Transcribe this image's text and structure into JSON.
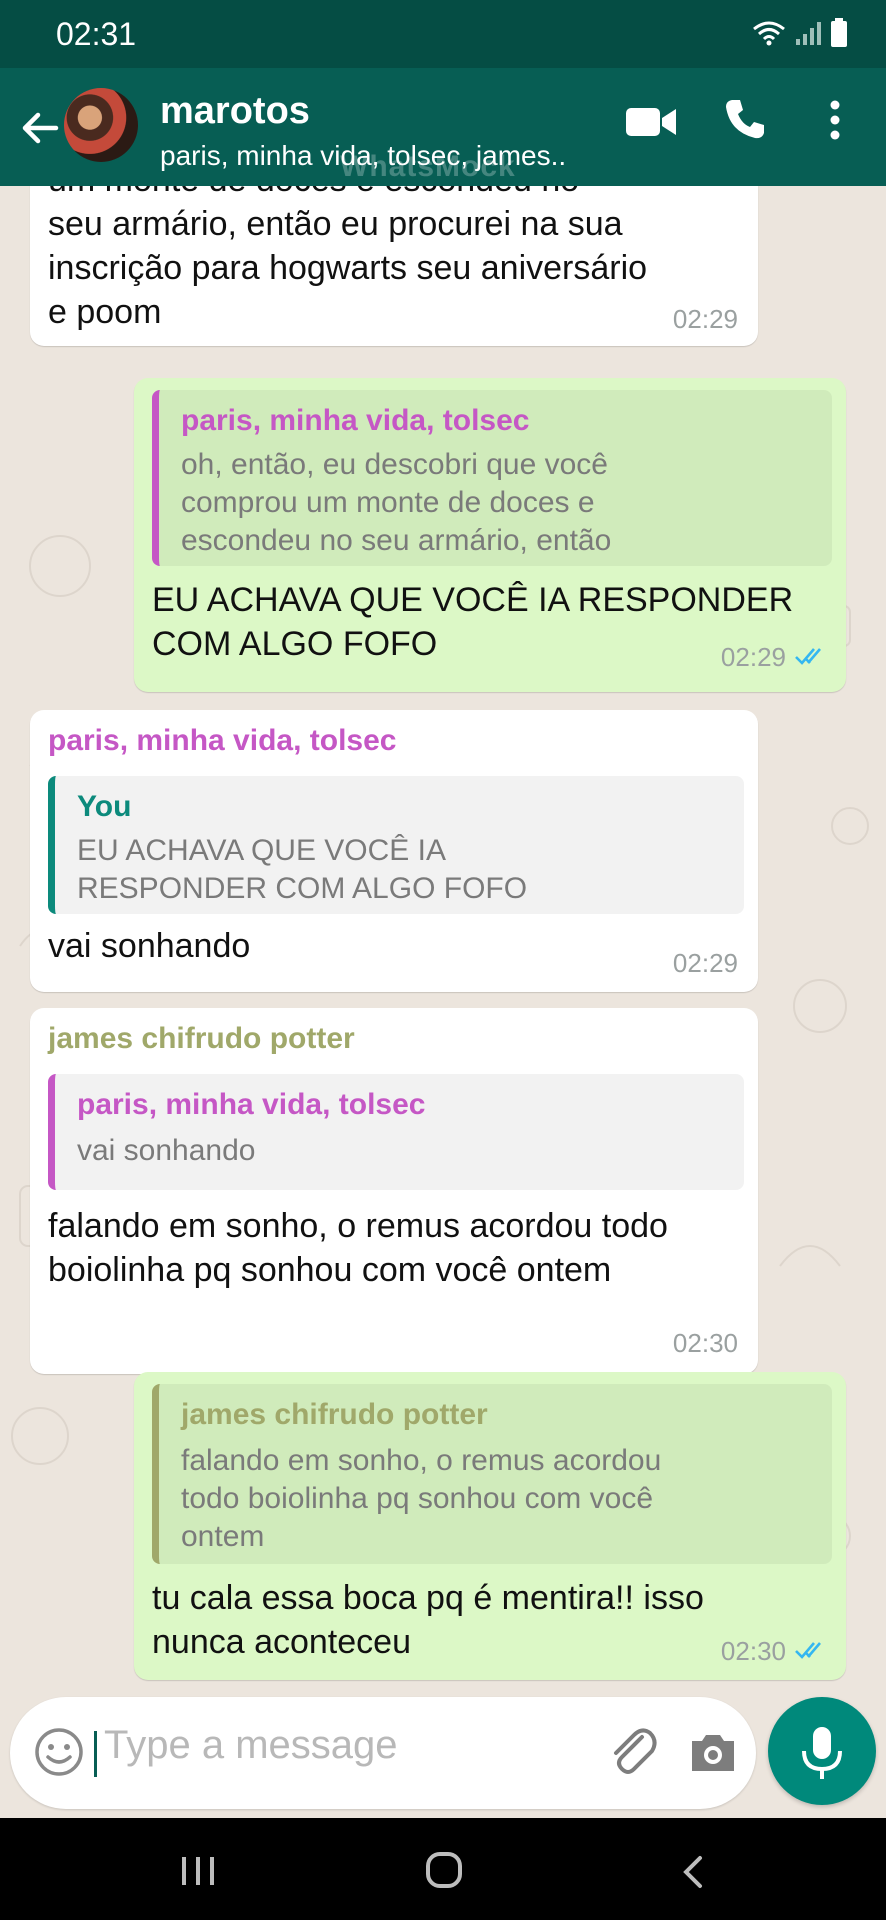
{
  "status_bar": {
    "time": "02:31"
  },
  "header": {
    "title": "marotos",
    "subtitle": "paris, minha vida, tolsec, james..",
    "watermark": "WhatsMock"
  },
  "messages": [
    {
      "direction": "in",
      "text_lines": [
        "um monte de doces e escondeu no",
        "seu armário, então eu procurei na sua",
        "inscrição para hogwarts seu aniversário",
        "e poom"
      ],
      "time": "02:29"
    },
    {
      "direction": "out",
      "quote": {
        "name": "paris, minha vida, tolsec",
        "text_lines": [
          "oh, então, eu descobri que você",
          "comprou um monte de doces e",
          "escondeu no seu armário, então"
        ]
      },
      "text_lines": [
        "EU ACHAVA QUE VOCÊ IA RESPONDER",
        "COM ALGO FOFO"
      ],
      "time": "02:29"
    },
    {
      "direction": "in",
      "sender": "paris, minha vida, tolsec",
      "quote": {
        "name": "You",
        "text_lines": [
          "EU ACHAVA QUE VOCÊ IA",
          "RESPONDER COM ALGO FOFO"
        ]
      },
      "text_lines": [
        "vai sonhando"
      ],
      "time": "02:29"
    },
    {
      "direction": "in",
      "sender": "james chifrudo potter",
      "quote": {
        "name": "paris, minha vida, tolsec",
        "text_lines": [
          "vai sonhando"
        ]
      },
      "text_lines": [
        "falando em sonho, o remus acordou todo",
        "boiolinha pq sonhou com você ontem"
      ],
      "time": "02:30"
    },
    {
      "direction": "out",
      "quote": {
        "name": "james chifrudo potter",
        "text_lines": [
          "falando em sonho, o remus acordou",
          "todo boiolinha pq sonhou com você",
          "ontem"
        ]
      },
      "text_lines": [
        "tu cala essa boca pq é mentira!! isso",
        "nunca aconteceu"
      ],
      "time": "02:30"
    }
  ],
  "input": {
    "placeholder": "Type a message"
  },
  "colors": {
    "header": "#075E54",
    "out_bubble": "#DCF8C6",
    "paris_name": "#C557C5",
    "james_name": "#A0A86A",
    "you_name": "#0C8A7C",
    "read_ticks": "#34B7F1"
  },
  "icons": [
    "back-arrow-icon",
    "video-call-icon",
    "voice-call-icon",
    "more-options-icon",
    "emoji-icon",
    "attach-icon",
    "camera-icon",
    "mic-icon",
    "recents-nav-icon",
    "home-nav-icon",
    "back-nav-icon"
  ]
}
